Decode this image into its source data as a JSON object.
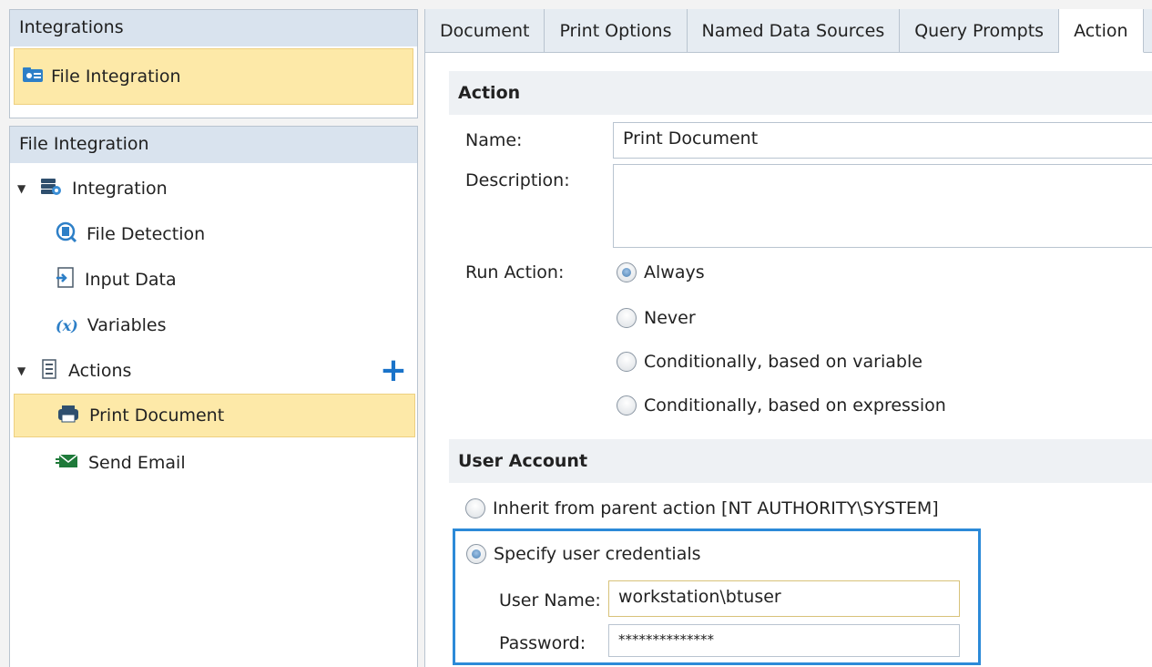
{
  "integrations_panel": {
    "header": "Integrations",
    "selected_item": "File Integration"
  },
  "file_panel": {
    "header": "File Integration",
    "tree": {
      "integration": "Integration",
      "file_detection": "File Detection",
      "input_data": "Input Data",
      "variables_prefix": "(x)",
      "variables": "Variables",
      "actions": "Actions",
      "add_glyph": "+",
      "print_document": "Print Document",
      "send_email": "Send Email"
    }
  },
  "tabs": [
    "Document",
    "Print Options",
    "Named Data Sources",
    "Query Prompts",
    "Action"
  ],
  "action_section": {
    "header": "Action",
    "name_label": "Name:",
    "name_value": "Print Document",
    "description_label": "Description:",
    "description_value": "",
    "run_action_label": "Run Action:",
    "run_options": [
      "Always",
      "Never",
      "Conditionally, based on variable",
      "Conditionally, based on expression"
    ],
    "run_selected": "Always"
  },
  "user_account_section": {
    "header": "User Account",
    "inherit_option": "Inherit from parent action [NT AUTHORITY\\SYSTEM]",
    "specify_option": "Specify user credentials",
    "user_name_label": "User Name:",
    "user_name_value": "workstation\\btuser",
    "password_label": "Password:",
    "password_value": "**************"
  },
  "colors": {
    "selection_bg": "#fde9a8",
    "focus_border": "#2c8ad8",
    "header_bg": "#d9e3ee",
    "add_icon": "#1a73c9"
  }
}
